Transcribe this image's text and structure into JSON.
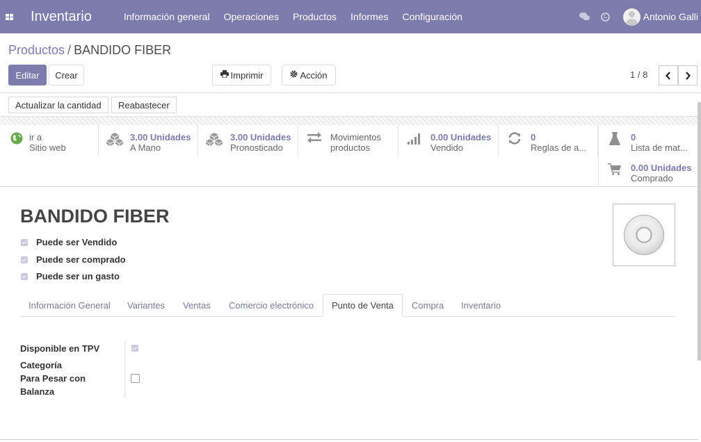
{
  "navbar": {
    "app_name": "Inventario",
    "menu": [
      "Información general",
      "Operaciones",
      "Productos",
      "Informes",
      "Configuración"
    ],
    "user_name": "Antonio Galli",
    "icons": [
      "apps-icon",
      "chat-icon",
      "clock-icon",
      "avatar"
    ]
  },
  "breadcrumb": {
    "parent": "Productos",
    "separator": "/",
    "current": "BANDIDO FIBER"
  },
  "toolbar": {
    "edit": "Editar",
    "create": "Crear",
    "print": "Imprimir",
    "action": "Acción"
  },
  "pager": {
    "text": "1 / 8",
    "prev": "‹",
    "next": "›"
  },
  "statusbar": {
    "update_qty": "Actualizar la cantidad",
    "replenish": "Reabastecer"
  },
  "smart_buttons": [
    {
      "value": "ir a",
      "label": "Sitio web",
      "icon": "globe-icon"
    },
    {
      "value": "3.00 Unidades",
      "label": "A Mano",
      "icon": "cubes-icon"
    },
    {
      "value": "3.00 Unidades",
      "label": "Pronosticado",
      "icon": "cubes-icon"
    },
    {
      "value": "Movimientos",
      "label": "productos",
      "icon": "exchange-icon"
    },
    {
      "value": "0.00 Unidades",
      "label": "Vendido",
      "icon": "signal-icon"
    },
    {
      "value": "0",
      "label": "Reglas de a...",
      "icon": "refresh-icon"
    },
    {
      "value": "0",
      "label": "Lista de mat...",
      "icon": "flask-icon"
    },
    {
      "value": "0.00 Unidades",
      "label": "Comprado",
      "icon": "cart-icon"
    }
  ],
  "product": {
    "name": "BANDIDO FIBER",
    "checks": [
      {
        "label": "Puede ser Vendido",
        "checked": true
      },
      {
        "label": "Puede ser comprado",
        "checked": true
      },
      {
        "label": "Puede ser un gasto",
        "checked": true
      }
    ]
  },
  "tabs": [
    "Información General",
    "Variantes",
    "Ventas",
    "Comercio electrónico",
    "Punto de Venta",
    "Compra",
    "Inventario"
  ],
  "active_tab": "Punto de Venta",
  "pos_fields": {
    "available_label": "Disponible en TPV",
    "available_checked": true,
    "category_label": "Categoría",
    "category_value": "",
    "weigh_label_1": "Para Pesar con",
    "weigh_label_2": "Balanza",
    "weigh_checked": false
  },
  "colors": {
    "brand": "#7c7bad",
    "checkbox": "#c9c8e0"
  }
}
